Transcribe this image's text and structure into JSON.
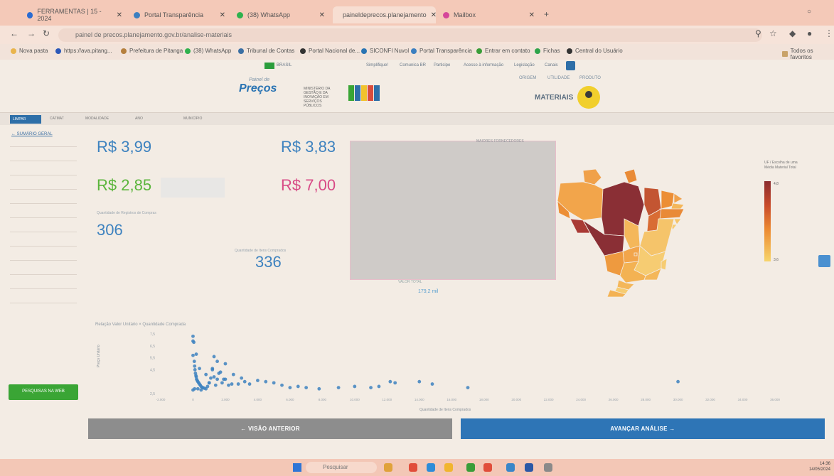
{
  "browser": {
    "tabs": [
      {
        "label": "FERRAMENTAS | 15 - 2024",
        "color": "#2a6bd1"
      },
      {
        "label": "Portal Transparência",
        "color": "#3c7fc0"
      },
      {
        "label": "(38) WhatsApp",
        "color": "#2fb14d"
      },
      {
        "label": "paineldeprecos.planejamento",
        "color": "#5a6f85"
      },
      {
        "label": "Mailbox",
        "color": "#d5479a"
      }
    ],
    "url": "painel de precos.planejamento.gov.br/analise-materiais",
    "bookmarks": [
      {
        "label": "Nova pasta",
        "color": "#e9b44c"
      },
      {
        "label": "https://ava.pitang...",
        "color": "#2c58b8"
      },
      {
        "label": "Prefeitura de Pitanga",
        "color": "#b57f3d"
      },
      {
        "label": "(38) WhatsApp",
        "color": "#2fb14d"
      },
      {
        "label": "Tribunal de Contas",
        "color": "#3b6fa3"
      },
      {
        "label": "Portal Nacional de...",
        "color": "#333333"
      },
      {
        "label": "SICONFI Nuvol",
        "color": "#2a74b3"
      },
      {
        "label": "Portal Transparência",
        "color": "#3c7fc0"
      },
      {
        "label": "Entrar em contato",
        "color": "#3a9d38"
      },
      {
        "label": "Fichas",
        "color": "#2fa34a"
      },
      {
        "label": "Central do Usuário",
        "color": "#333333"
      }
    ],
    "all_bookmarks": "Todos os favoritos"
  },
  "gov": {
    "brand_small": "Painel de",
    "brand": "Preços",
    "ministry": "MINISTÉRIO DA GESTÃO E DA INOVAÇÃO EM SERVIÇOS PÚBLICOS",
    "section": "MATERIAIS",
    "gov_label": "BRASIL",
    "govbar_links": [
      "Simplifique!",
      "Comunica BR",
      "Participe",
      "Acesso à informação",
      "Legislação",
      "Canais"
    ],
    "top_links": [
      "ORIGEM",
      "UTILIDADE",
      "PRODUTO"
    ]
  },
  "filters": {
    "clear_label": "LIMPAR",
    "tags": [
      "CATMAT",
      "MODALIDADE",
      "ANO",
      "MUNICÍPIO"
    ]
  },
  "sidebar": {
    "link": "← SUMÁRIO GERAL",
    "search_button": "PESQUISAS NA WEB"
  },
  "kpis": {
    "avg": "R$ 3,99",
    "median": "R$ 3,83",
    "min": "R$ 2,85",
    "max": "R$ 7,00",
    "qty_purchases": "306",
    "qty_label": "Quantidade de Registros de Compras",
    "qty_items": "336",
    "qty_items_label": "Quantidade de Itens Comprados",
    "colors": {
      "avg": "#3d82bf",
      "median": "#3d82bf",
      "min": "#5ab53b",
      "max": "#d84a86",
      "count": "#3d82bf"
    }
  },
  "panel": {
    "title": "MAIORES FORNECEDORES",
    "footer_label": "VALOR TOTAL",
    "footer_value": "179,2 mil"
  },
  "map": {
    "legend_title": "UF / Escolha de uma Média Material Total",
    "legend_min": "3,6",
    "legend_max": "4,8",
    "regions": [
      {
        "name": "RR",
        "color": "#f0a14a"
      },
      {
        "name": "AP",
        "color": "#e98b36"
      },
      {
        "name": "AM",
        "color": "#f2a54b"
      },
      {
        "name": "PA",
        "color": "#8a2f35"
      },
      {
        "name": "MA",
        "color": "#c35532"
      },
      {
        "name": "CE",
        "color": "#ec8e35"
      },
      {
        "name": "RN",
        "color": "#f0a14a"
      },
      {
        "name": "PB",
        "color": "#f4b75a"
      },
      {
        "name": "PE",
        "color": "#e98a38"
      },
      {
        "name": "PI",
        "color": "#d96c34"
      },
      {
        "name": "AL",
        "color": "#f5c56a"
      },
      {
        "name": "SE",
        "color": "#f6cc72"
      },
      {
        "name": "BA",
        "color": "#f5c46a"
      },
      {
        "name": "AC",
        "color": "#ec8e35"
      },
      {
        "name": "RO",
        "color": "#a93a35"
      },
      {
        "name": "MT",
        "color": "#8a2f35"
      },
      {
        "name": "TO",
        "color": "#f4b75a"
      },
      {
        "name": "GO",
        "color": "#f2a54b"
      },
      {
        "name": "DF",
        "color": "#f2a54b"
      },
      {
        "name": "MS",
        "color": "#ee9a3f"
      },
      {
        "name": "MG",
        "color": "#f6cc72"
      },
      {
        "name": "ES",
        "color": "#f6cc72"
      },
      {
        "name": "RJ",
        "color": "#f4b75a"
      },
      {
        "name": "SP",
        "color": "#f3b253"
      },
      {
        "name": "PR",
        "color": "#f4b75a"
      },
      {
        "name": "SC",
        "color": "#f6cc72"
      },
      {
        "name": "RS",
        "color": "#f3b253"
      }
    ]
  },
  "scatter": {
    "title": "Relação Valor Unitário × Quantidade Comprada",
    "xlabel": "Quantidade de Itens Comprados",
    "ylabel": "Preço Unitário",
    "chart_data": {
      "type": "scatter",
      "title": "Relação Valor Unitário × Quantidade Comprada",
      "xlabel": "Quantidade de Itens Comprados",
      "ylabel": "Preço Unitário",
      "xlim": [
        -2000,
        36000
      ],
      "ylim": [
        2.5,
        7.5
      ],
      "xticks": [
        "-2.000",
        "0",
        "2.000",
        "4.000",
        "6.000",
        "8.000",
        "10.000",
        "12.000",
        "14.000",
        "16.000",
        "18.000",
        "20.000",
        "22.000",
        "24.000",
        "26.000",
        "28.000",
        "30.000",
        "32.000",
        "34.000",
        "36.000"
      ],
      "yticks": [
        "2,5",
        "4,5",
        "5,5",
        "6,5",
        "7,5"
      ],
      "x": [
        0,
        0,
        0,
        50,
        80,
        100,
        120,
        150,
        180,
        200,
        220,
        260,
        300,
        350,
        400,
        450,
        500,
        600,
        700,
        800,
        900,
        1000,
        1100,
        1200,
        1300,
        1400,
        1500,
        1600,
        1800,
        2000,
        2200,
        2500,
        2800,
        3000,
        3200,
        3500,
        4000,
        4500,
        5000,
        5500,
        6000,
        6500,
        7000,
        7800,
        9000,
        10000,
        11000,
        11500,
        12200,
        12500,
        14000,
        14800,
        17000,
        30000,
        300,
        500,
        1000,
        1500,
        2000,
        1200,
        800,
        2400,
        1900,
        0,
        100,
        600,
        1300,
        1700,
        200,
        400
      ],
      "y": [
        7.3,
        6.9,
        5.7,
        6.8,
        5.2,
        4.8,
        4.5,
        4.2,
        4.0,
        3.9,
        3.7,
        3.6,
        3.5,
        3.4,
        3.3,
        3.2,
        3.1,
        3.0,
        2.95,
        2.9,
        3.1,
        3.4,
        3.8,
        4.6,
        5.6,
        3.2,
        3.7,
        4.2,
        3.4,
        3.7,
        3.2,
        4.1,
        3.3,
        3.8,
        3.5,
        3.3,
        3.6,
        3.5,
        3.4,
        3.2,
        3.0,
        3.1,
        3.0,
        2.9,
        3.0,
        3.1,
        3.0,
        3.1,
        3.5,
        3.4,
        3.5,
        3.3,
        3.0,
        3.5,
        2.9,
        2.8,
        3.4,
        5.2,
        5.0,
        4.5,
        4.1,
        3.3,
        3.7,
        2.8,
        2.9,
        3.0,
        3.9,
        4.3,
        5.8,
        4.6
      ]
    }
  },
  "nav": {
    "prev": "←  VISÃO ANTERIOR",
    "next": "AVANÇAR ANÁLISE  →"
  },
  "taskbar": {
    "search": "Pesquisar",
    "time": "14:36",
    "date": "14/05/2024"
  }
}
